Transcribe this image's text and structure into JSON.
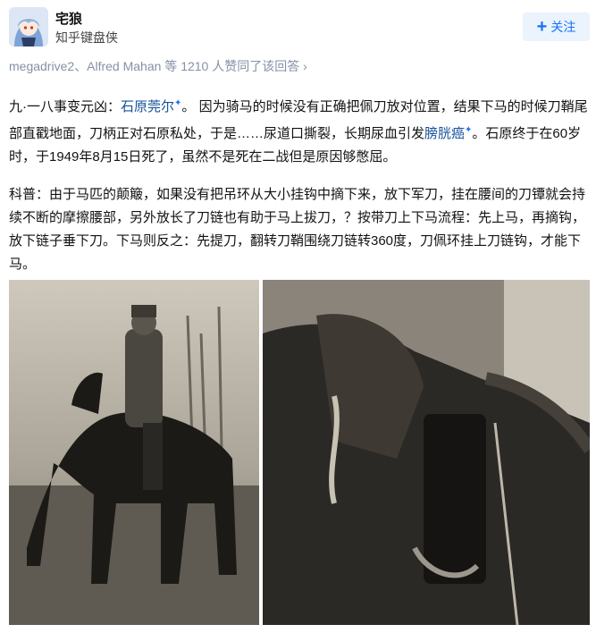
{
  "author": {
    "name": "宅狼",
    "headline": "知乎键盘侠",
    "follow_label": "关注"
  },
  "voters_text": "megadrive2、Alfred Mahan 等 1210 人赞同了该回答",
  "paragraph1": {
    "prefix": "九·一八事变元凶：",
    "link1": "石原莞尔",
    "middle": "。 因为骑马的时候没有正确把佩刀放对位置，结果下马的时候刀鞘尾部直戳地面，刀柄正对石原私处，于是……尿道口撕裂，长期尿血引发",
    "link2": "膀胱癌",
    "suffix": "。石原终于在60岁时，于1949年8月15日死了，虽然不是死在二战但是原因够憋屈。"
  },
  "paragraph2": {
    "text": "科普：由于马匹的颠簸，如果没有把吊环从大小挂钩中摘下来，放下军刀，挂在腰间的刀镡就会持续不断的摩擦腰部，另外放长了刀链也有助于马上拔刀，？按带刀上下马流程：先上马，再摘钩，放下链子垂下刀。下马则反之：先提刀，翻转刀鞘围绕刀链转360度，刀佩环挂上刀链钩，才能下马。"
  },
  "icons": {
    "follow": "plus-icon",
    "voters_arrow": "chevron-right-icon",
    "link_marker": "sparkle-icon"
  },
  "colors": {
    "link": "#175199",
    "accent": "#1772f6",
    "follow_bg": "#ebf3fd",
    "meta": "#8590a6"
  }
}
